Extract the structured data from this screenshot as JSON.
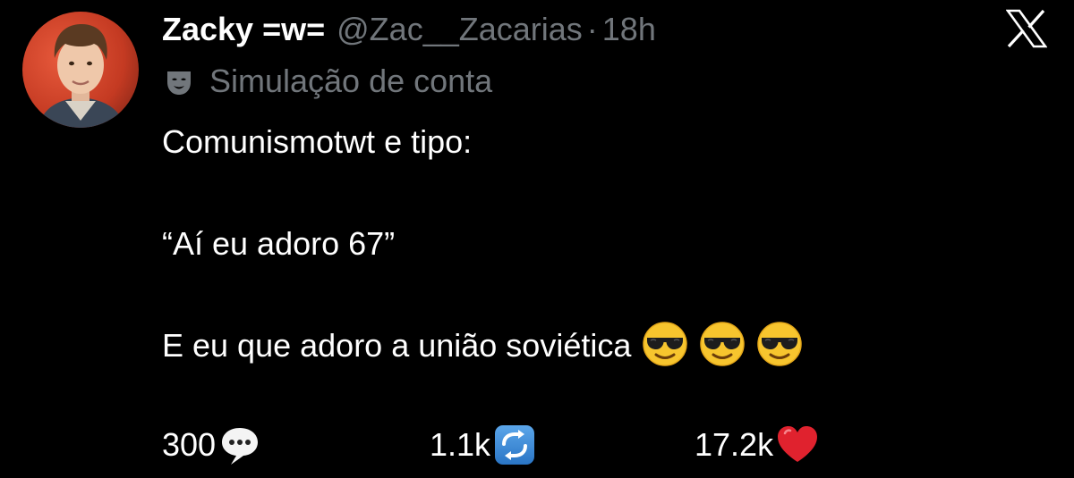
{
  "author": {
    "display_name": "Zacky =w=",
    "handle": "@Zac__Zacarias",
    "separator": "·",
    "time_ago": "18h",
    "parody_label": "Simulação de conta",
    "parody_icon": "parody-mask-icon",
    "avatar_icon": "avatar-photo"
  },
  "tweet": {
    "lines": [
      "Comunismotwt e tipo:",
      "",
      "“Aí eu adoro 67”",
      "",
      "E eu que adoro a união soviética"
    ],
    "emoji_icons": [
      "sunglasses-face-emoji",
      "sunglasses-face-emoji",
      "sunglasses-face-emoji"
    ]
  },
  "actions": {
    "replies": {
      "count": "300",
      "icon": "speech-balloon-emoji"
    },
    "reposts": {
      "count": "1.1k",
      "icon": "repeat-arrows-emoji"
    },
    "likes": {
      "count": "17.2k",
      "icon": "red-heart-emoji"
    }
  },
  "close": {
    "icon": "x-logo-icon"
  },
  "colors": {
    "background": "#000000",
    "text_primary": "#ffffff",
    "text_secondary": "#71767b",
    "heart": "#e0222e",
    "repeat_blue": "#3b8ddb"
  }
}
